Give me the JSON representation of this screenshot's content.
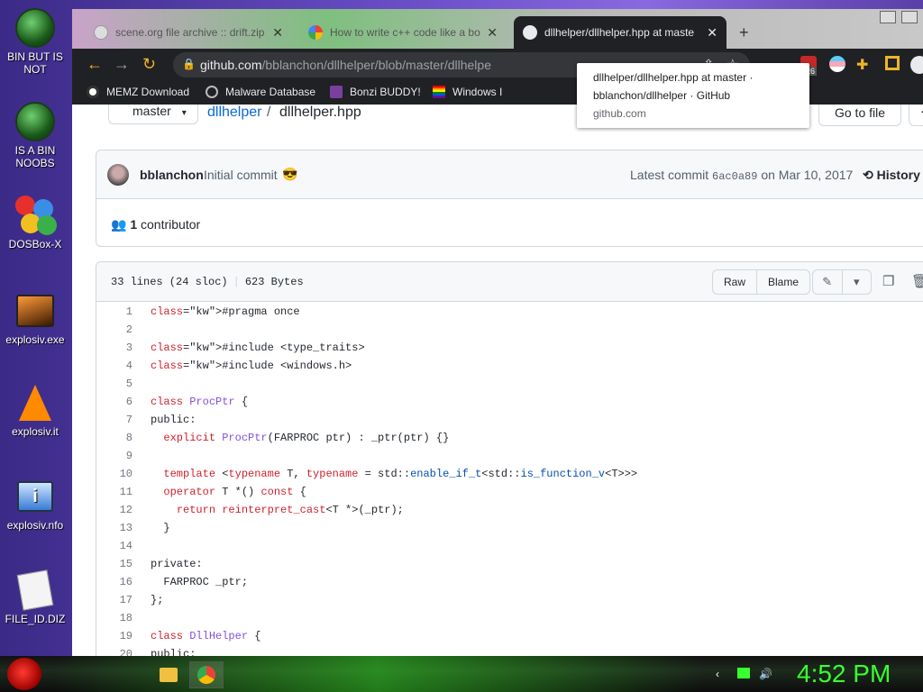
{
  "desktop": {
    "icons": [
      {
        "label_1": "BIN BUT IS",
        "label_2": "NOT"
      },
      {
        "label_1": "IS A BIN",
        "label_2": "NOOBS"
      },
      {
        "label_1": "DOSBox-X"
      },
      {
        "label_1": "explosiv.exe"
      },
      {
        "label_1": "explosiv.it"
      },
      {
        "label_1": "explosiv.nfo"
      },
      {
        "label_1": "FILE_ID.DIZ"
      }
    ]
  },
  "browser": {
    "tabs": [
      {
        "title": "scene.org file archive :: drift.zip",
        "icon": "scene-org-icon"
      },
      {
        "title": "How to write c++ code like a bo",
        "icon": "google-icon"
      },
      {
        "title": "dllhelper/dllhelper.hpp at maste",
        "icon": "github-icon",
        "active": true
      }
    ],
    "new_tab": "+",
    "url_host": "github.com",
    "url_path": "/bblanchon/dllhelper/blob/master/dllhelpe",
    "extension_badge": "26",
    "bookmarks": [
      {
        "label": "MEMZ Download",
        "icon": "memz-icon"
      },
      {
        "label": "Malware Database",
        "icon": "globe-icon"
      },
      {
        "label": "Bonzi BUDDY!",
        "icon": "bonzi-icon"
      },
      {
        "label": "Windows I",
        "icon": "rainbow-flag-icon"
      }
    ],
    "tooltip": {
      "line1": "dllhelper/dllhelper.hpp at master ·",
      "line2": "bblanchon/dllhelper · GitHub",
      "line3": "github.com"
    }
  },
  "page": {
    "branch": "master",
    "repo": "dllhelper",
    "separator": "/",
    "file": "dllhelper.hpp",
    "goto_file": "Go to file",
    "more": "···",
    "commit": {
      "author": "bblanchon",
      "message": "Initial commit",
      "emoji": "😎",
      "latest_prefix": "Latest commit",
      "sha": "6ac0a89",
      "date": "on Mar 10, 2017",
      "history": "History"
    },
    "contributors": {
      "count": "1",
      "label": "contributor"
    },
    "file_info": {
      "lines": "33 lines (24 sloc)",
      "size": "623 Bytes"
    },
    "buttons": {
      "raw": "Raw",
      "blame": "Blame"
    },
    "code_lines": [
      "#pragma once",
      "",
      "#include <type_traits>",
      "#include <windows.h>",
      "",
      "class ProcPtr {",
      "public:",
      "  explicit ProcPtr(FARPROC ptr) : _ptr(ptr) {}",
      "",
      "  template <typename T, typename = std::enable_if_t<std::is_function_v<T>>>",
      "  operator T *() const {",
      "    return reinterpret_cast<T *>(_ptr);",
      "  }",
      "",
      "private:",
      "  FARPROC _ptr;",
      "};",
      "",
      "class DllHelper {",
      "public:"
    ]
  },
  "taskbar": {
    "clock": "4:52 PM"
  }
}
